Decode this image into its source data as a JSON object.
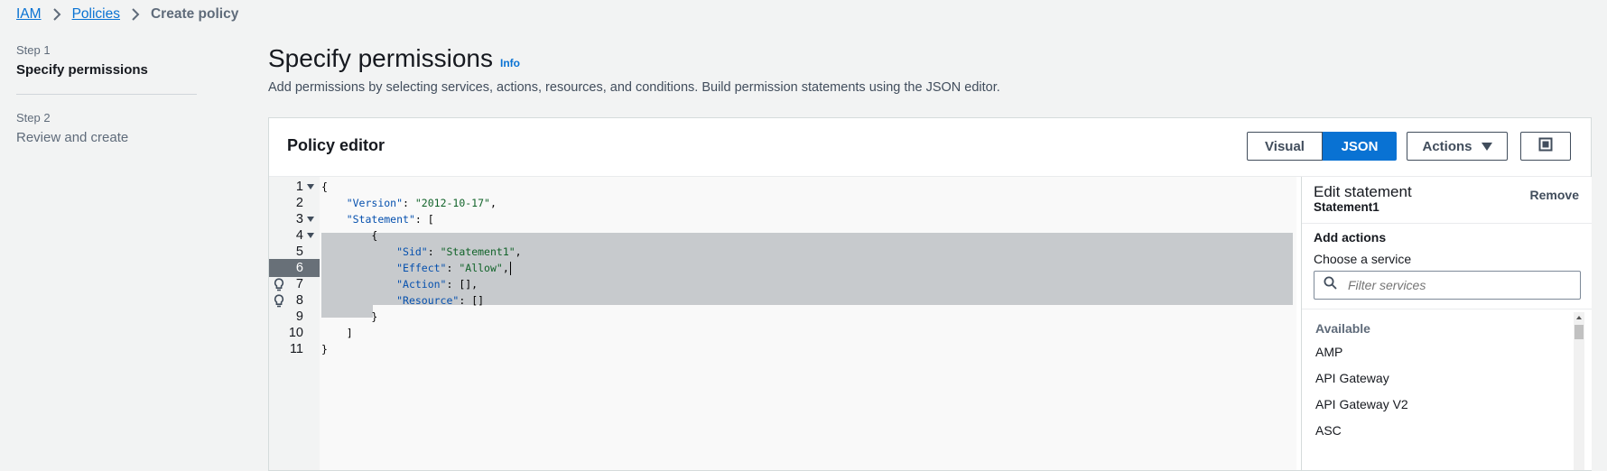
{
  "breadcrumb": {
    "items": [
      "IAM",
      "Policies"
    ],
    "current": "Create policy"
  },
  "steps": [
    {
      "number": "Step 1",
      "title": "Specify permissions"
    },
    {
      "number": "Step 2",
      "title": "Review and create"
    }
  ],
  "header": {
    "title": "Specify permissions",
    "info": "Info",
    "description": "Add permissions by selecting services, actions, resources, and conditions. Build permission statements using the JSON editor."
  },
  "editor": {
    "title": "Policy editor",
    "mode_visual": "Visual",
    "mode_json": "JSON",
    "actions_label": "Actions",
    "line_numbers": [
      "1",
      "2",
      "3",
      "4",
      "5",
      "6",
      "7",
      "8",
      "9",
      "10",
      "11"
    ],
    "code": {
      "l1": "{",
      "l2_key": "\"Version\"",
      "l2_val": "\"2012-10-17\"",
      "l3_key": "\"Statement\"",
      "l3_rest": ": [",
      "l4": "{",
      "l5_key": "\"Sid\"",
      "l5_val": "\"Statement1\"",
      "l6_key": "\"Effect\"",
      "l6_val": "\"Allow\"",
      "l7_key": "\"Action\"",
      "l7_rest": ": [],",
      "l8_key": "\"Resource\"",
      "l8_rest": ": []",
      "l9": "}",
      "l10": "]",
      "l11": "}"
    }
  },
  "panel": {
    "title": "Edit statement",
    "subtitle": "Statement1",
    "remove": "Remove",
    "add_actions": "Add actions",
    "choose_service": "Choose a service",
    "search_placeholder": "Filter services",
    "available_label": "Available",
    "services": [
      "AMP",
      "API Gateway",
      "API Gateway V2",
      "ASC"
    ]
  },
  "colors": {
    "accent": "#0972d3",
    "selection": "#c7cacd",
    "current_line": "#687078"
  }
}
